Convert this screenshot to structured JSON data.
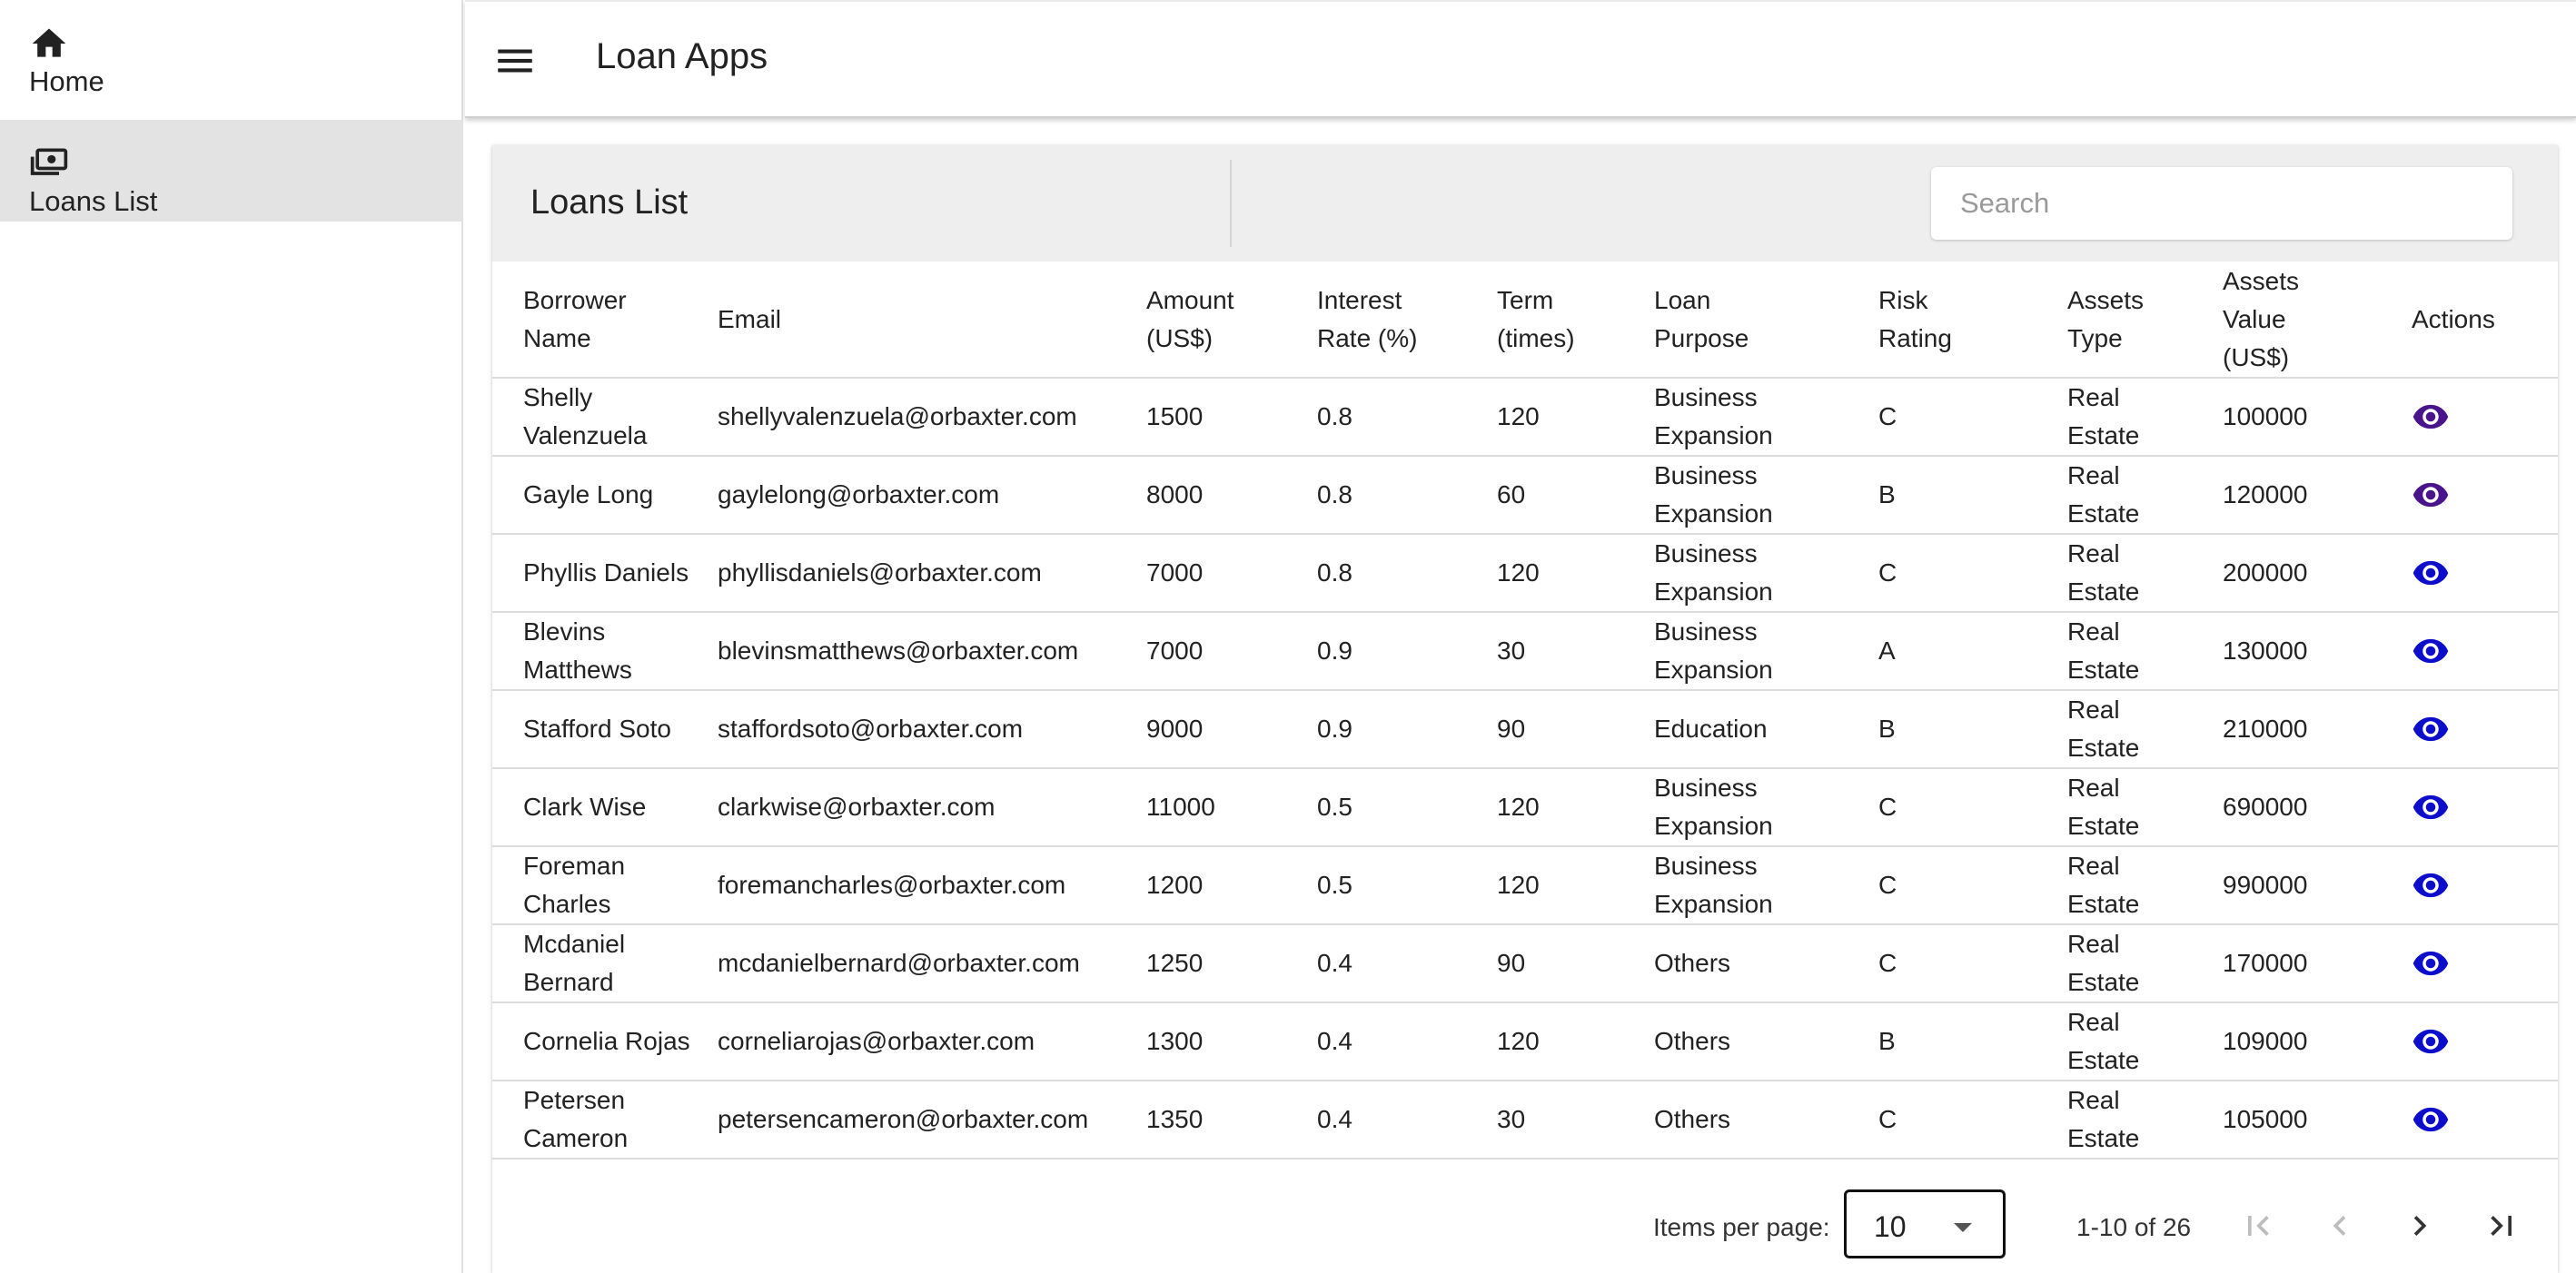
{
  "app": {
    "title": "Loan Apps"
  },
  "sidebar": {
    "items": [
      {
        "label": "Home",
        "icon": "home-icon",
        "active": false
      },
      {
        "label": "Loans List",
        "icon": "money-icon",
        "active": true
      }
    ]
  },
  "page": {
    "title": "Loans List"
  },
  "search": {
    "placeholder": "Search",
    "value": ""
  },
  "table": {
    "columns": [
      "Borrower Name",
      "Email",
      "Amount (US$)",
      "Interest Rate (%)",
      "Term (times)",
      "Loan Purpose",
      "Risk Rating",
      "Assets Type",
      "Assets Value (US$)",
      "Actions"
    ],
    "rows": [
      [
        "Shelly Valenzuela",
        "shellyvalenzuela@orbaxter.com",
        "1500",
        "0.8",
        "120",
        "Business Expansion",
        "C",
        "Real Estate",
        "100000"
      ],
      [
        "Gayle Long",
        "gaylelong@orbaxter.com",
        "8000",
        "0.8",
        "60",
        "Business Expansion",
        "B",
        "Real Estate",
        "120000"
      ],
      [
        "Phyllis Daniels",
        "phyllisdaniels@orbaxter.com",
        "7000",
        "0.8",
        "120",
        "Business Expansion",
        "C",
        "Real Estate",
        "200000"
      ],
      [
        "Blevins Matthews",
        "blevinsmatthews@orbaxter.com",
        "7000",
        "0.9",
        "30",
        "Business Expansion",
        "A",
        "Real Estate",
        "130000"
      ],
      [
        "Stafford Soto",
        "staffordsoto@orbaxter.com",
        "9000",
        "0.9",
        "90",
        "Education",
        "B",
        "Real Estate",
        "210000"
      ],
      [
        "Clark Wise",
        "clarkwise@orbaxter.com",
        "11000",
        "0.5",
        "120",
        "Business Expansion",
        "C",
        "Real Estate",
        "690000"
      ],
      [
        "Foreman Charles",
        "foremancharles@orbaxter.com",
        "1200",
        "0.5",
        "120",
        "Business Expansion",
        "C",
        "Real Estate",
        "990000"
      ],
      [
        "Mcdaniel Bernard",
        "mcdanielbernard@orbaxter.com",
        "1250",
        "0.4",
        "90",
        "Others",
        "C",
        "Real Estate",
        "170000"
      ],
      [
        "Cornelia Rojas",
        "corneliarojas@orbaxter.com",
        "1300",
        "0.4",
        "120",
        "Others",
        "B",
        "Real Estate",
        "109000"
      ],
      [
        "Petersen Cameron",
        "petersencameron@orbaxter.com",
        "1350",
        "0.4",
        "30",
        "Others",
        "C",
        "Real Estate",
        "105000"
      ]
    ],
    "action_icon": "eye-icon",
    "action_colors": [
      "#4a148c",
      "#4a148c",
      "#0d0dcc",
      "#0d0dcc",
      "#0d0dcc",
      "#0d0dcc",
      "#0d0dcc",
      "#0d0dcc",
      "#0d0dcc",
      "#0d0dcc"
    ]
  },
  "paginator": {
    "items_per_page_label": "Items per page:",
    "items_per_page": "10",
    "range_label": "1-10 of 26"
  }
}
